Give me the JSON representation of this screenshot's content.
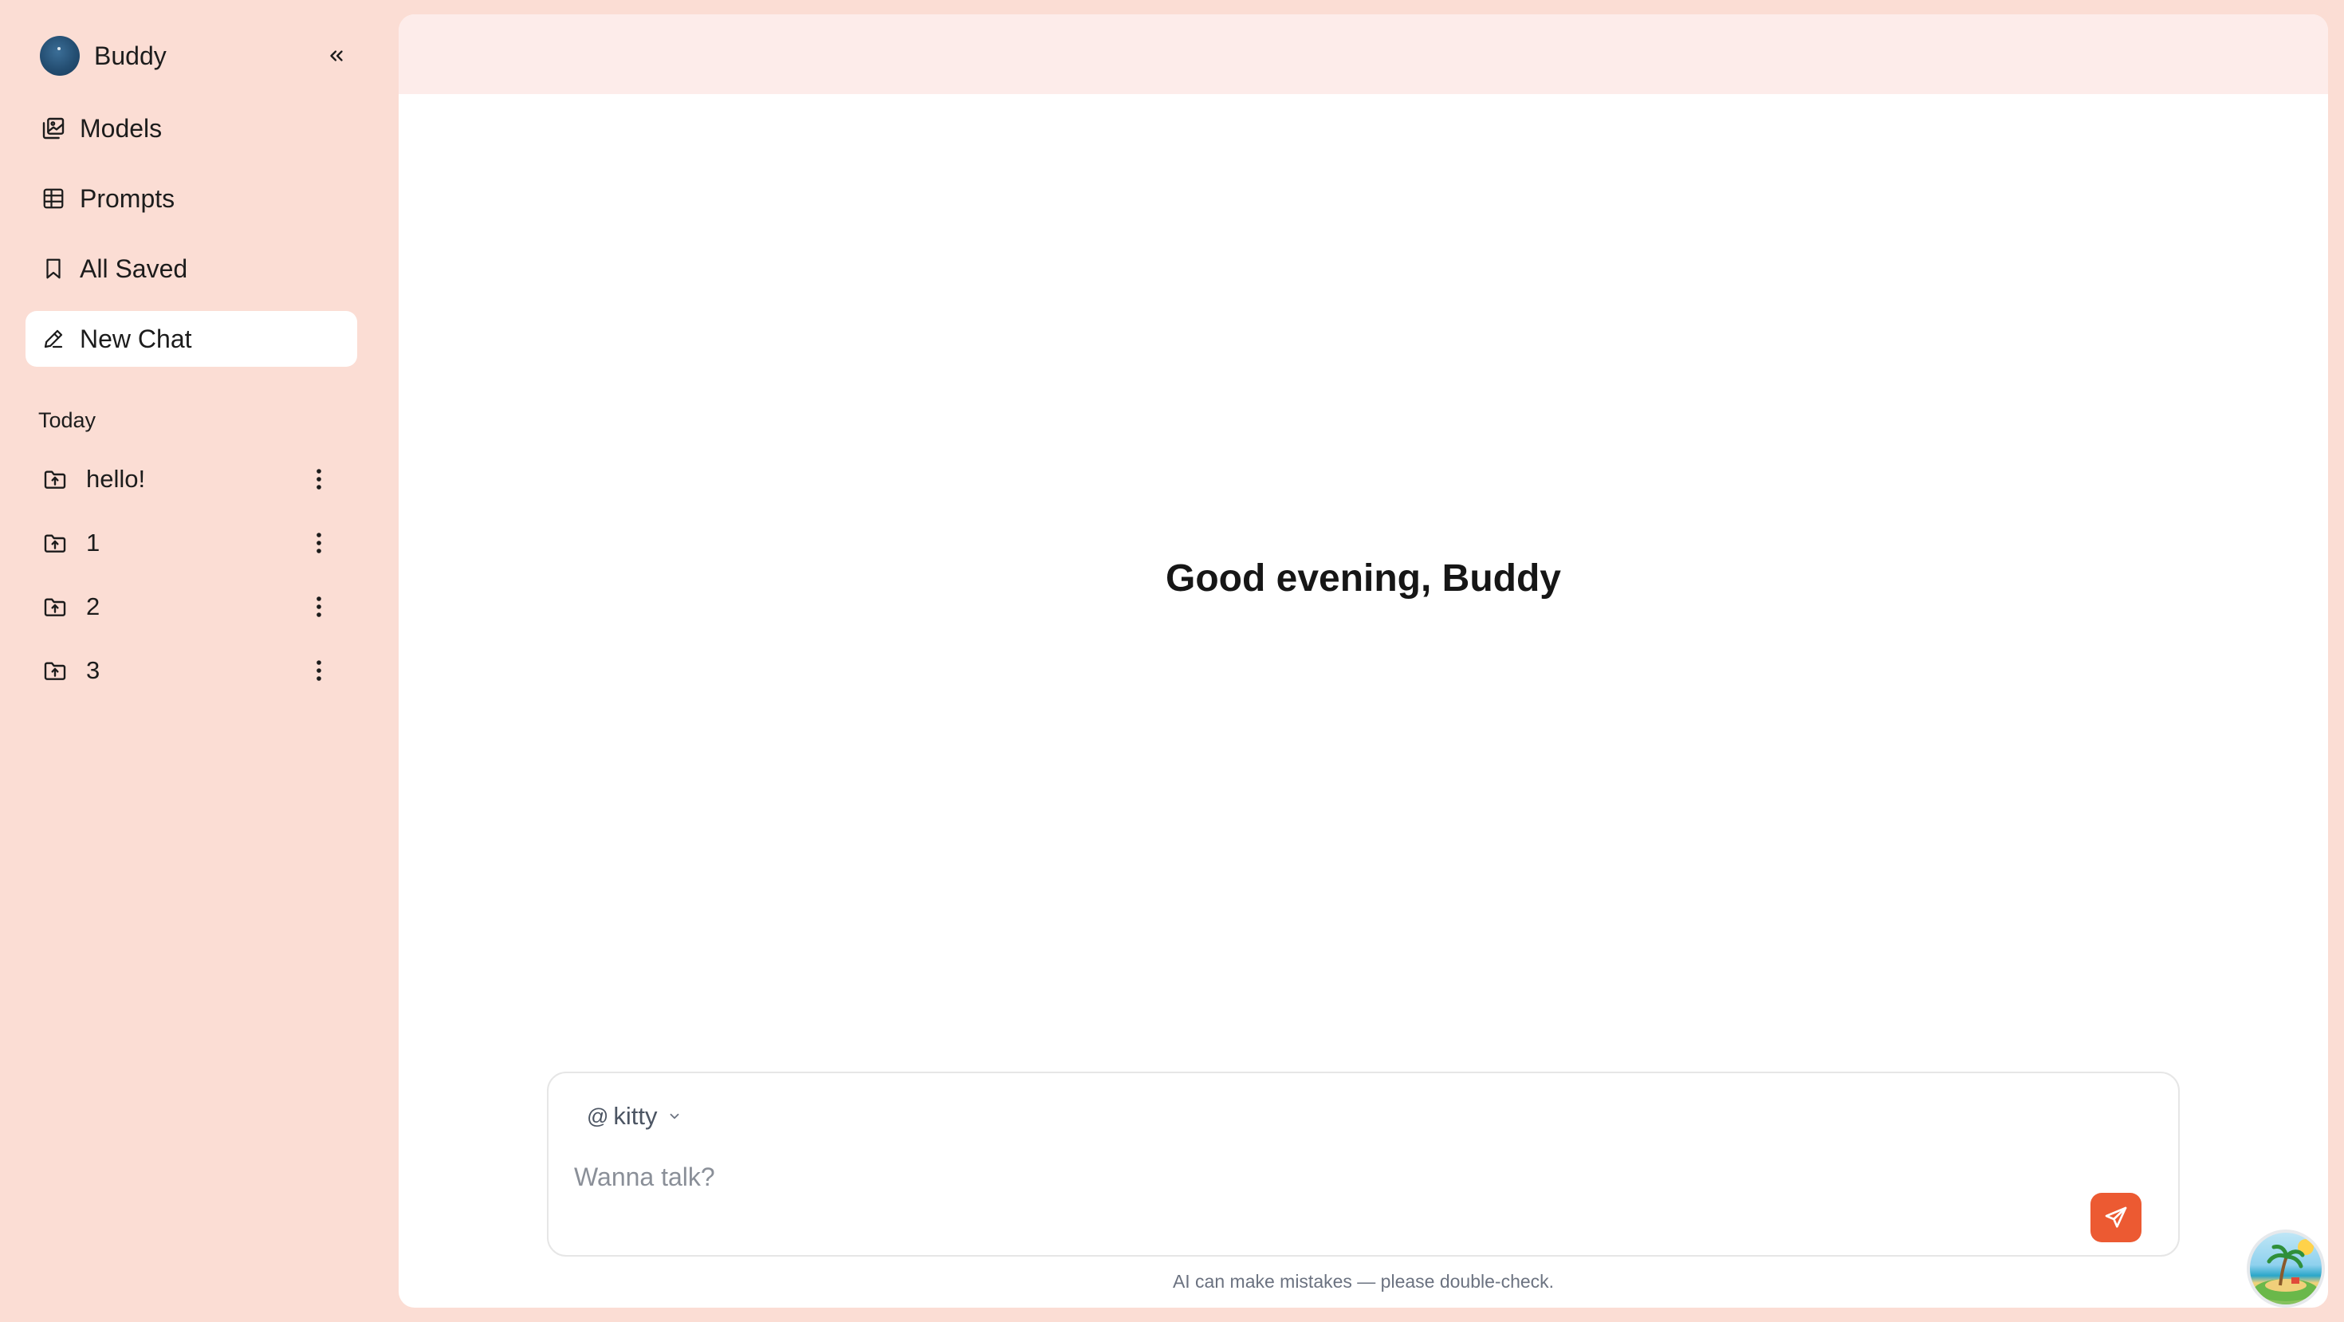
{
  "brand": {
    "name": "Buddy"
  },
  "nav": {
    "items": [
      {
        "label": "Models",
        "icon": "models-icon"
      },
      {
        "label": "Prompts",
        "icon": "table-icon"
      },
      {
        "label": "All Saved",
        "icon": "bookmark-icon"
      },
      {
        "label": "New Chat",
        "icon": "pencil-icon"
      }
    ]
  },
  "history": {
    "section_label": "Today",
    "items": [
      {
        "label": "hello!"
      },
      {
        "label": "1"
      },
      {
        "label": "2"
      },
      {
        "label": "3"
      }
    ]
  },
  "main": {
    "greeting": "Good evening, Buddy",
    "composer": {
      "model_prefix": "@",
      "model_name": "kitty",
      "placeholder": "Wanna talk?"
    },
    "disclaimer": "AI can make mistakes — please double-check."
  },
  "colors": {
    "background": "#fbddd4",
    "topbar": "#fdecea",
    "accent": "#ec5a32"
  }
}
